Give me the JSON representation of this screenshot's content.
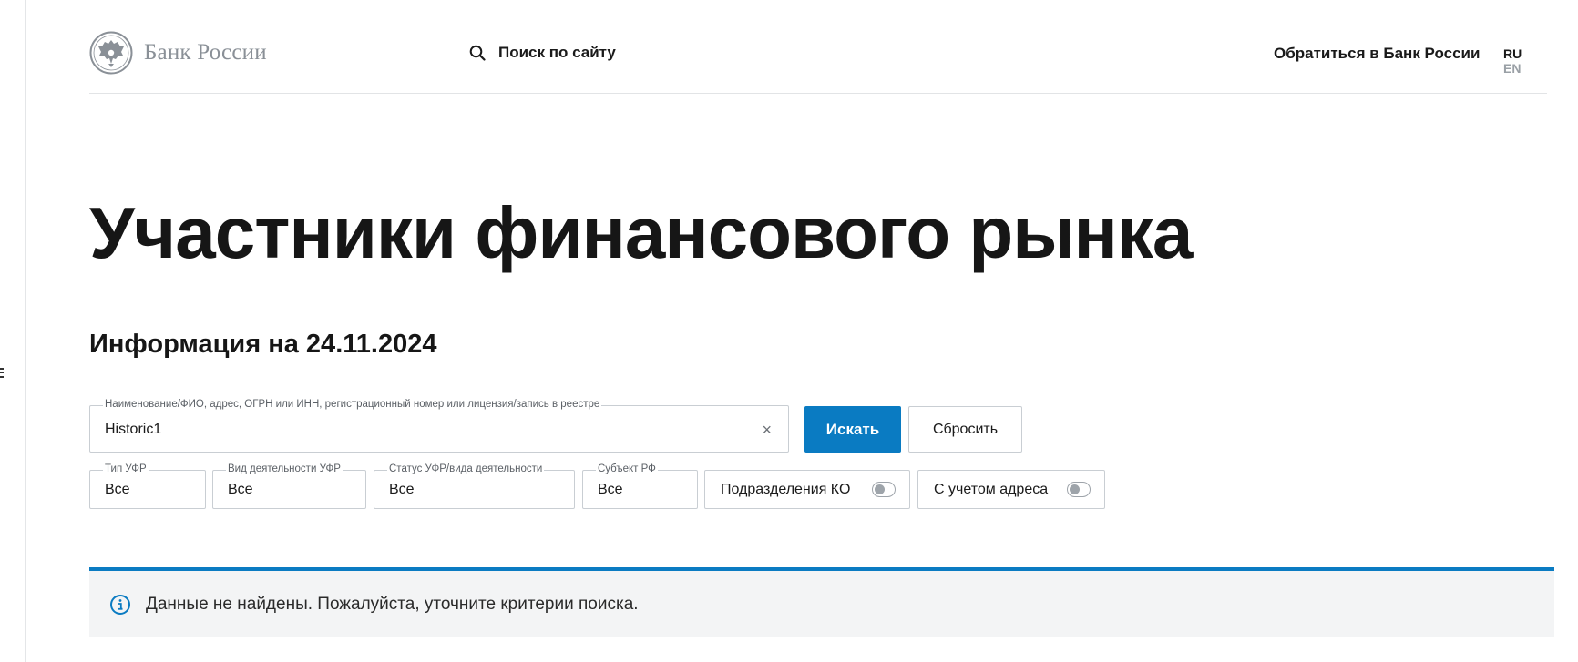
{
  "header": {
    "logo_text": "Банк России",
    "search_label": "Поиск по сайту",
    "contact_label": "Обратиться в Банк России",
    "lang": {
      "ru": "RU",
      "en": "EN"
    }
  },
  "main": {
    "title": "Участники финансового рынка",
    "subtitle": "Информация на 24.11.2024"
  },
  "search": {
    "legend": "Наименование/ФИО, адрес, ОГРН или ИНН, регистрационный номер или лицензия/запись в реестре",
    "value": "Historic1",
    "clear_symbol": "×",
    "search_button": "Искать",
    "reset_button": "Сбросить"
  },
  "filters": [
    {
      "legend": "Тип УФР",
      "value": "Все"
    },
    {
      "legend": "Вид деятельности УФР",
      "value": "Все"
    },
    {
      "legend": "Статус УФР/вида деятельности",
      "value": "Все"
    },
    {
      "legend": "Субъект РФ",
      "value": "Все"
    }
  ],
  "toggles": [
    {
      "label": "Подразделения КО",
      "on": false
    },
    {
      "label": "С учетом адреса",
      "on": false
    }
  ],
  "notice": {
    "text": "Данные не найдены. Пожалуйста, уточните критерии поиска."
  },
  "colors": {
    "accent": "#0a7bc2",
    "notice_bg": "#f3f4f5",
    "logo_gray": "#8a9097"
  }
}
